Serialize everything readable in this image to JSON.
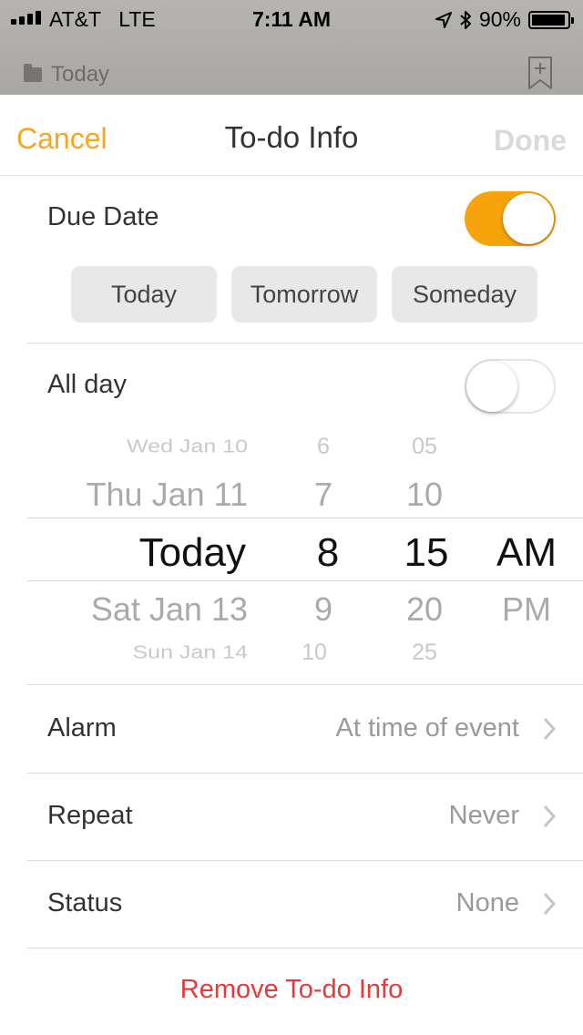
{
  "status_bar": {
    "carrier": "AT&T",
    "network": "LTE",
    "time": "7:11 AM",
    "battery": "90%",
    "signal_icon": "signal-bars-icon",
    "location_icon": "location-arrow-icon",
    "bluetooth_icon": "bluetooth-icon",
    "battery_icon": "battery-icon"
  },
  "background_app": {
    "folder_label": "Today",
    "bookmark_icon": "bookmark-add-icon"
  },
  "navbar": {
    "cancel_label": "Cancel",
    "title": "To-do Info",
    "done_label": "Done"
  },
  "due_date": {
    "label": "Due Date",
    "enabled": true,
    "quick_options": [
      "Today",
      "Tomorrow",
      "Someday"
    ]
  },
  "all_day": {
    "label": "All day",
    "enabled": false
  },
  "picker": {
    "dates": [
      "Wed Jan 10",
      "Thu Jan 11",
      "Today",
      "Sat Jan 13",
      "Sun Jan 14"
    ],
    "hours": [
      "6",
      "7",
      "8",
      "9",
      "10"
    ],
    "minutes": [
      "05",
      "10",
      "15",
      "20",
      "25"
    ],
    "ampm": [
      "AM",
      "PM"
    ],
    "selected": {
      "date": "Today",
      "hour": "8",
      "minute": "15",
      "ampm": "AM"
    }
  },
  "settings": [
    {
      "label": "Alarm",
      "value": "At time of event"
    },
    {
      "label": "Repeat",
      "value": "Never"
    },
    {
      "label": "Status",
      "value": "None"
    }
  ],
  "remove_label": "Remove To-do Info",
  "colors": {
    "accent": "#f5a623",
    "toggle_on": "#f7a30b",
    "destructive": "#e6393a",
    "disabled": "#dadada"
  }
}
